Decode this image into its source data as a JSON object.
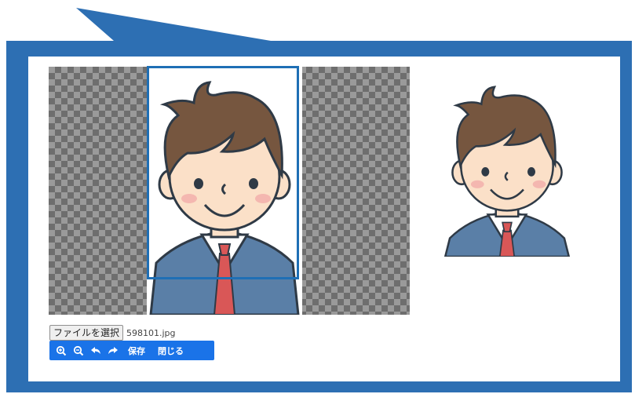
{
  "colors": {
    "frame": "#2d6fb3",
    "crop_border": "#1f6fb5",
    "toolbar": "#1a73e8"
  },
  "file_input": {
    "button_label": "ファイルを選択",
    "file_name": "598101.jpg"
  },
  "toolbar": {
    "zoom_in_icon": "zoom-in-icon",
    "zoom_out_icon": "zoom-out-icon",
    "rotate_left_icon": "rotate-left-icon",
    "rotate_right_icon": "rotate-right-icon",
    "save_label": "保存",
    "close_label": "閉じる"
  }
}
